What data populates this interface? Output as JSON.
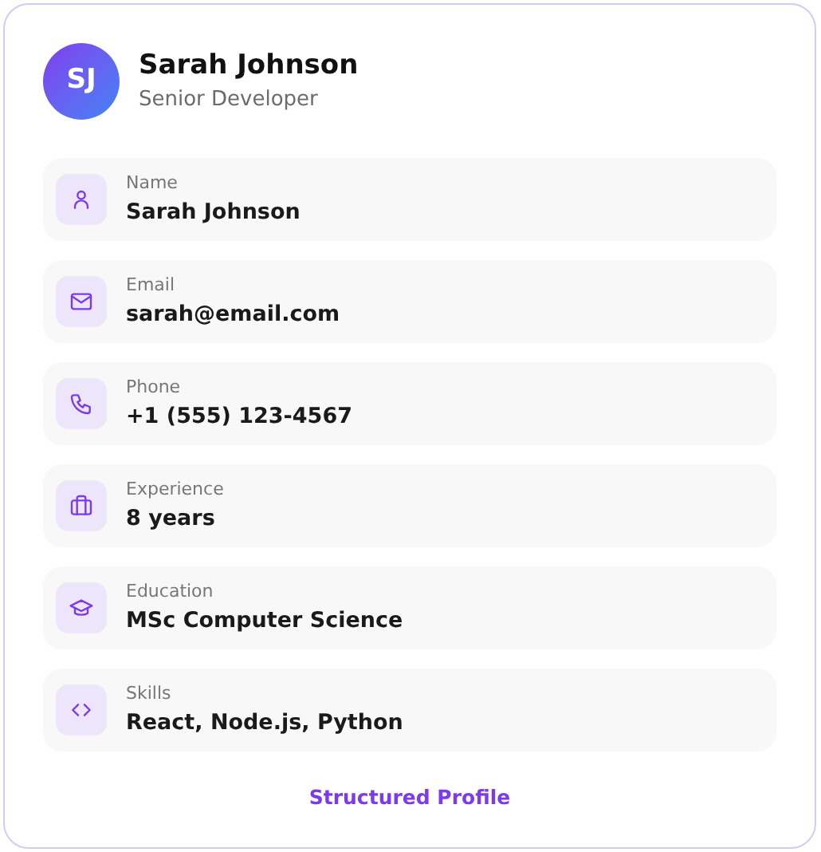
{
  "profile": {
    "initials": "SJ",
    "name": "Sarah Johnson",
    "title": "Senior Developer"
  },
  "fields": [
    {
      "kind": "name",
      "label": "Name",
      "value": "Sarah Johnson"
    },
    {
      "kind": "email",
      "label": "Email",
      "value": "sarah@email.com"
    },
    {
      "kind": "phone",
      "label": "Phone",
      "value": "+1 (555) 123-4567"
    },
    {
      "kind": "experience",
      "label": "Experience",
      "value": "8 years"
    },
    {
      "kind": "education",
      "label": "Education",
      "value": "MSc Computer Science"
    },
    {
      "kind": "skills",
      "label": "Skills",
      "value": "React, Node.js, Python"
    }
  ],
  "footer": "Structured Profile"
}
